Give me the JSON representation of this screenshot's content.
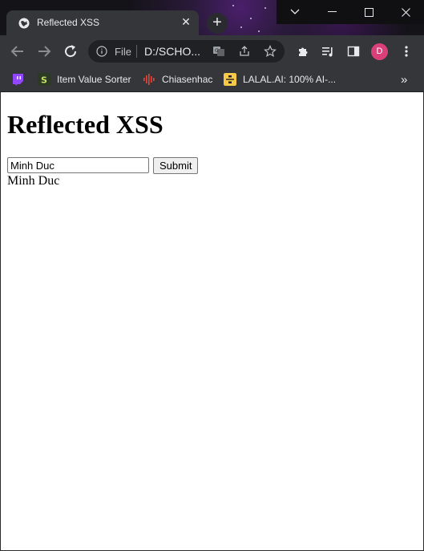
{
  "tab": {
    "title": "Reflected XSS",
    "close": "✕"
  },
  "new_tab": "+",
  "window_controls": {
    "dropdown": "chevron-down",
    "minimize": "—",
    "maximize": "☐",
    "close": "✕"
  },
  "omnibox": {
    "scheme_label": "File",
    "url": "D:/SCHO..."
  },
  "avatar_letter": "D",
  "bookmarks": [
    {
      "label": "",
      "icon": "twitch-icon"
    },
    {
      "label": "Item Value Sorter",
      "icon": "s-icon"
    },
    {
      "label": "Chiasenhac",
      "icon": "soundwave-icon"
    },
    {
      "label": "LALAL.AI: 100% AI-...",
      "icon": "lalal-icon"
    }
  ],
  "bookmarks_overflow": "»",
  "page": {
    "heading": "Reflected XSS",
    "input_value": "Minh Duc",
    "submit_label": "Submit",
    "output_text": "Minh Duc"
  },
  "colors": {
    "chrome_dark": "#35363a",
    "omnibox_bg": "#202124",
    "avatar": "#d9407a"
  }
}
